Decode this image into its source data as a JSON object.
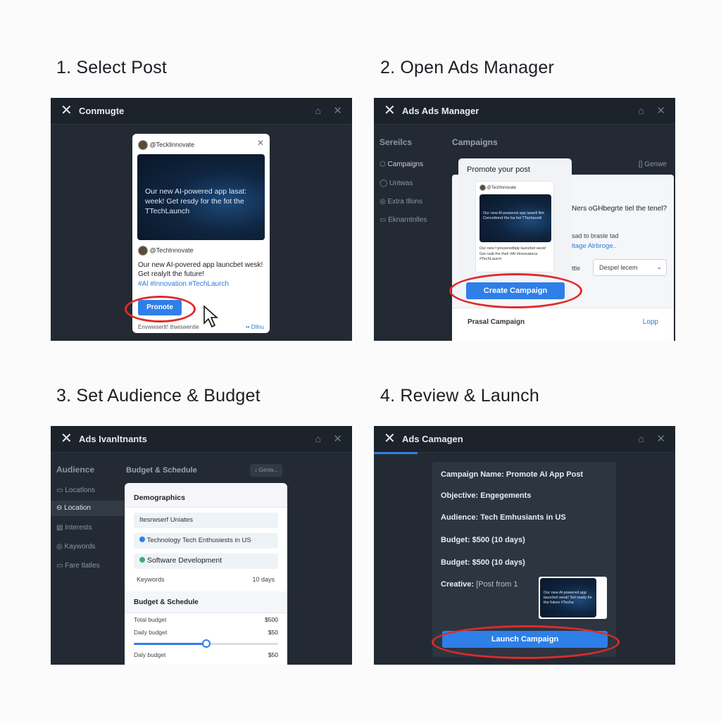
{
  "steps": {
    "s1": "1. Select Post",
    "s2": "2. Open Ads Manager",
    "s3": "3. Set Audience & Budget",
    "s4": "4. Review & Launch"
  },
  "panel1": {
    "title": "Conmugte",
    "handle1": "@Tecklinnovate",
    "img_text": "Our new AI-powered app lasat: week! Get resdy for the fot the TTechLaunch",
    "handle2": "@Techlnnovate",
    "body": "Our new AI-povered app launcbet wesk! Get realyIt the future!",
    "hashtags": "#Al #Innovation #TechLaurch",
    "promote": "Pronote",
    "footer_left": "Envwwsertt! thwiswentie",
    "footer_right": "•• Dllnu"
  },
  "panel2": {
    "title": "Ads Ads Manager",
    "sidebar_head": "Sereilcs",
    "sidebar": [
      "Campaigns",
      "Untwas",
      "Extra tllons",
      "Eknarntnlles"
    ],
    "main_head": "Campaigns",
    "header_right": "[] Genwe",
    "promote_head": "Promote your post",
    "mini_handle": "@Techlnnovate",
    "mini_img_text": "Our new AI-powered app laswill Bet Cencettoret the ba hel TTachaurdt",
    "mini_body": "Our new f pnsxeredtipp launcbet wesk! Get rsalt lhe thei! #Al #innovatoca #TechLaurch",
    "create": "Create Campaign",
    "question": "Ners oGHbegrte tiel the tenel?",
    "link_pre": "sad to brasle tad",
    "link": "ltage Alrbroge..",
    "select_label": "ttle",
    "select_val": "Despel lecem",
    "proposal": "Prasal Campaign",
    "proposal_link": "Lopp"
  },
  "panel3": {
    "title": "Ads Ivanltnants",
    "sidebar_head": "Audience",
    "sidebar": [
      "Locatlons",
      "Location",
      "Interests",
      "Kaywords",
      "Fare tlatles"
    ],
    "main_head": "Budget & Schedule",
    "header_btn": "↕ Genw...",
    "demo_head": "Demographics",
    "opt1": "Itesrwserf Uniates",
    "opt2": "Technology Tech Enthusiests in US",
    "opt3": "Software Development",
    "keywords": "Keywords",
    "keywords_val": "10 days",
    "budget_head": "Budget & Schedule",
    "total_budget": "Total budget",
    "total_val": "$500",
    "daily1": "Daily budget",
    "daily1_val": "$50",
    "slider_level": 0.5,
    "daily2": "Daly budget",
    "daily2_val": "$50"
  },
  "panel4": {
    "title": "Ads Camagen",
    "name": "Campaign Name: Promote AI App Post",
    "objective": "Objective: Engegements",
    "audience": "Audience: Tech Emhusiants in US",
    "budget1": "Budget: $500 (10 days)",
    "budget2": "Budget: $500 (10 days)",
    "creative_label": "Creative:",
    "creative_val": "[Post from 1",
    "thumb_text": "Our new AI-powered app launcbel wesk! Set ready for the future #Techa",
    "launch": "Launch Campaign"
  },
  "icons": {
    "close": "close-icon",
    "home": "home-icon",
    "cursor": "cursor-icon"
  },
  "colors": {
    "accent": "#2f7fe8",
    "highlight_ring": "#e02a2a",
    "panel_bg": "#232a33"
  }
}
